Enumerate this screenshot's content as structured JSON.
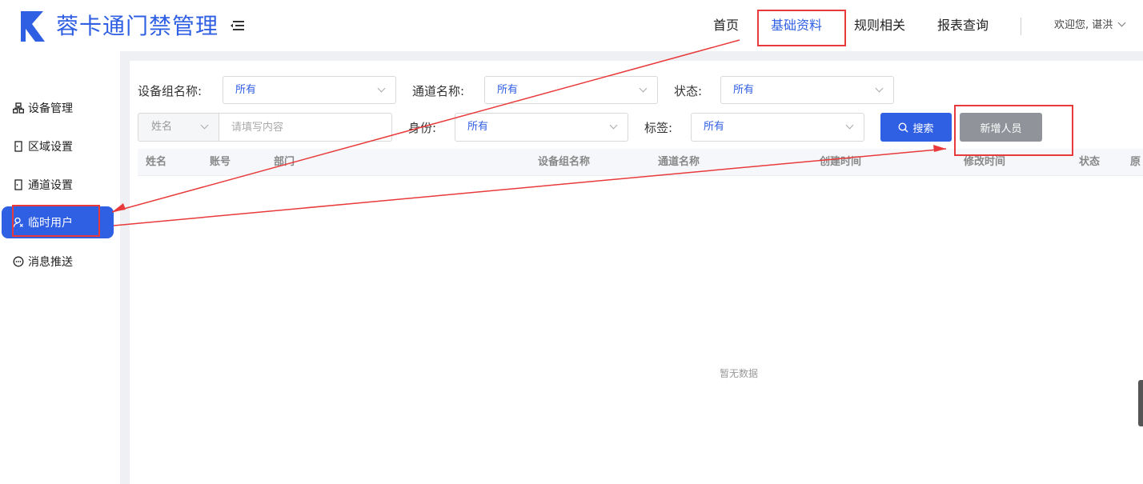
{
  "app": {
    "title": "蓉卡通门禁管理",
    "brand_color": "#2f5fe3",
    "logo_icon": "logo-icon",
    "menu_icon": "hamburger-menu-icon"
  },
  "nav": {
    "home": "首页",
    "basic_data": "基础资料",
    "rules": "规则相关",
    "reports": "报表查询",
    "active": "基础资料"
  },
  "user": {
    "welcome": "欢迎您, 谌洪"
  },
  "sidebar": {
    "items": [
      {
        "label": "设备管理",
        "icon": "device-group-icon"
      },
      {
        "label": "区域设置",
        "icon": "door-icon"
      },
      {
        "label": "通道设置",
        "icon": "door-icon"
      },
      {
        "label": "临时用户",
        "icon": "user-icon",
        "active": true
      },
      {
        "label": "消息推送",
        "icon": "message-icon"
      }
    ]
  },
  "filters": {
    "device_group_label": "设备组名称:",
    "device_group_value": "所有",
    "channel_label": "通道名称:",
    "channel_value": "所有",
    "status_label": "状态:",
    "status_value": "所有",
    "field_select_value": "姓名",
    "keyword_placeholder": "请填写内容",
    "identity_label": "身份:",
    "identity_value": "所有",
    "tag_label": "标签:",
    "tag_value": "所有"
  },
  "buttons": {
    "search": "搜索",
    "add_person": "新增人员"
  },
  "table": {
    "columns": [
      "姓名",
      "账号",
      "部门",
      "设备组名称",
      "通道名称",
      "创建时间",
      "修改时间",
      "状态",
      "原"
    ],
    "empty_text": "暂无数据"
  },
  "annotation_color": "#e83a3a"
}
